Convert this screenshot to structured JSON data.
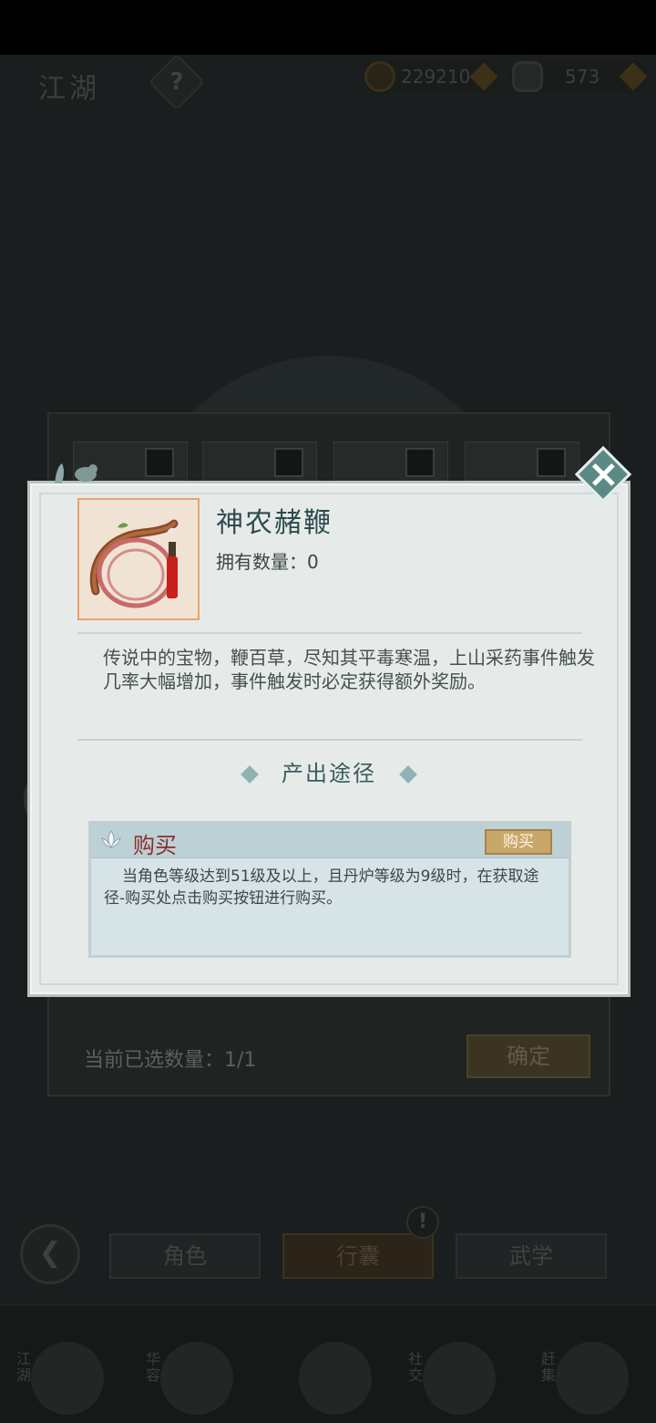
{
  "header": {
    "title": "江湖",
    "help": "?",
    "coins": "229210",
    "silver": "573"
  },
  "panel": {
    "selected_label": "当前已选数量：",
    "selected_value": "1/1",
    "confirm": "确定"
  },
  "tabs": [
    "角色",
    "行囊",
    "武学"
  ],
  "nav": [
    {
      "label": "江湖",
      "icon": "compass-icon"
    },
    {
      "label": "华容",
      "icon": "bird-icon"
    },
    {
      "label": "",
      "icon": "star-icon"
    },
    {
      "label": "社交",
      "icon": "wave-icon"
    },
    {
      "label": "赶集",
      "icon": "basket-icon"
    }
  ],
  "modal": {
    "item_name": "神农赭鞭",
    "owned_label": "拥有数量：",
    "owned_value": "0",
    "description": "传说中的宝物，鞭百草，尽知其平毒寒温，上山采药事件触发几率大幅增加，事件触发时必定获得额外奖励。",
    "source_title": "产出途径",
    "route": {
      "name": "购买",
      "button": "购买",
      "text": "当角色等级达到51级及以上，且丹炉等级为9级时，在获取途径-购买处点击购买按钮进行购买。"
    }
  },
  "colors": {
    "accent_teal": "#5b8a86",
    "route_name_red": "#8a2f2a",
    "buy_gold": "#c9a76a"
  }
}
